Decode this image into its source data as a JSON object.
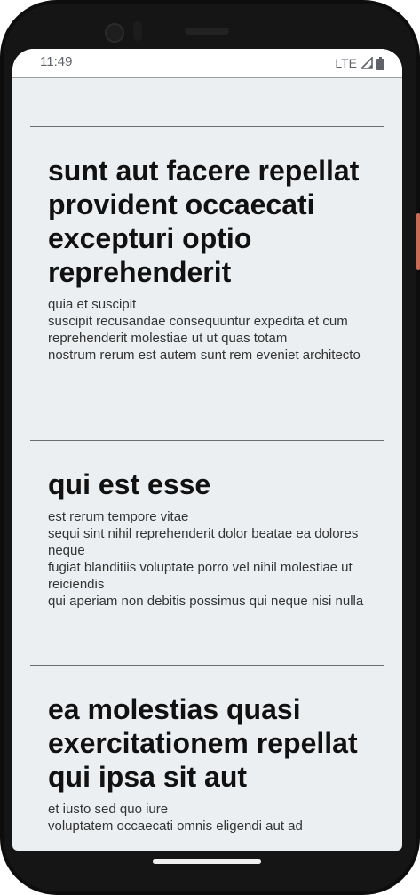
{
  "status_bar": {
    "time": "11:49",
    "network": "LTE"
  },
  "posts": [
    {
      "title": "sunt aut facere repellat provident occaecati excepturi optio reprehenderit",
      "body": "quia et suscipit\nsuscipit recusandae consequuntur expedita et cum\nreprehenderit molestiae ut ut quas totam\nnostrum rerum est autem sunt rem eveniet architecto"
    },
    {
      "title": "qui est esse",
      "body": "est rerum tempore vitae\nsequi sint nihil reprehenderit dolor beatae ea dolores neque\nfugiat blanditiis voluptate porro vel nihil molestiae ut reiciendis\nqui aperiam non debitis possimus qui neque nisi nulla"
    },
    {
      "title": "ea molestias quasi exercitationem repellat qui ipsa sit aut",
      "body": "et iusto sed quo iure\nvoluptatem occaecati omnis eligendi aut ad"
    }
  ],
  "colors": {
    "screen_bg": "#eceff1",
    "title_text": "#111111",
    "body_text": "#333333",
    "divider": "#6e6e6e",
    "accent_button": "#c96b55"
  }
}
